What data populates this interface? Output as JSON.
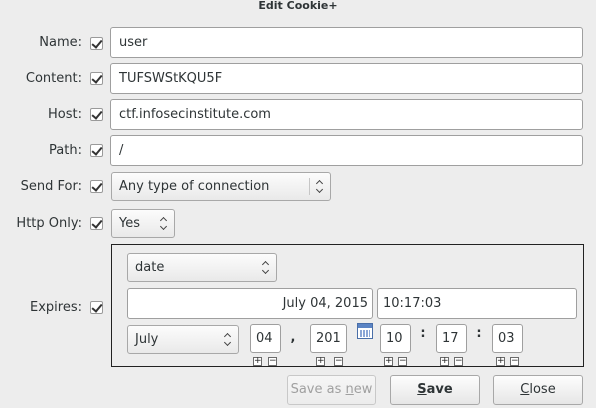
{
  "window": {
    "title": "Edit Cookie+"
  },
  "fields": {
    "name": {
      "label": "Name:",
      "value": "user"
    },
    "content": {
      "label": "Content:",
      "value": "TUFSWStKQU5F"
    },
    "host": {
      "label": "Host:",
      "value": "ctf.infosecinstitute.com"
    },
    "path": {
      "label": "Path:",
      "value": "/"
    },
    "send_for": {
      "label": "Send For:",
      "value": "Any type of connection"
    },
    "http_only": {
      "label": "Http Only:",
      "value": "Yes"
    },
    "expires": {
      "label": "Expires:",
      "mode": "date",
      "date_text": "July 04, 2015",
      "time_text": "10:17:03",
      "month": "July",
      "day": "04",
      "year": "201",
      "day_separator": ",",
      "hour": "10",
      "minute": "17",
      "second": "03",
      "colon": ":"
    }
  },
  "buttons": {
    "save_as_new": {
      "prefix": "Save as ",
      "mnemonic": "n",
      "suffix": "ew",
      "enabled": false
    },
    "save": {
      "mnemonic": "S",
      "suffix": "ave"
    },
    "close": {
      "mnemonic": "C",
      "suffix": "lose"
    }
  },
  "icons": {
    "checkbox": "checkmark-icon",
    "combo": "updown-arrows-icon",
    "calendar": "calendar-icon",
    "plus": "+",
    "minus": "−"
  }
}
